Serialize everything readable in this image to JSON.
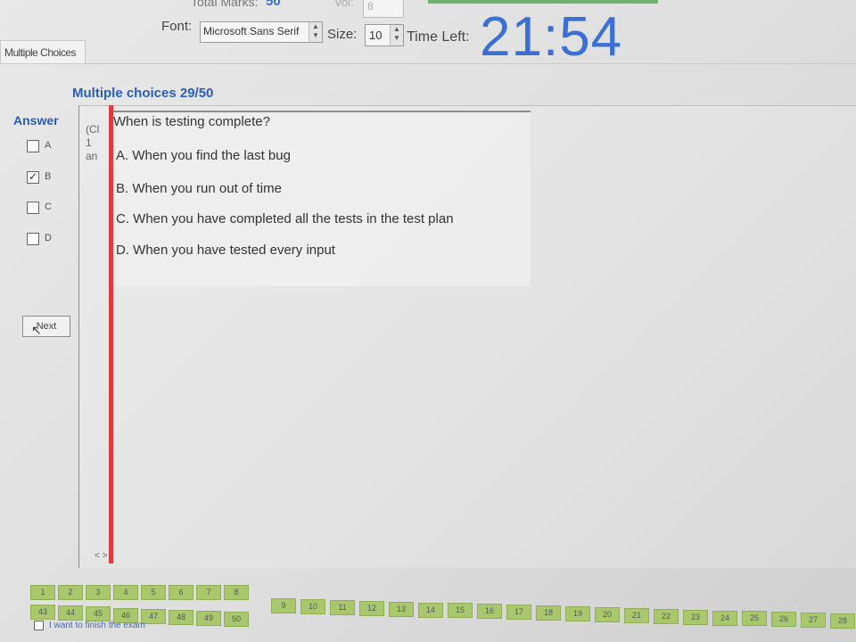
{
  "header": {
    "total_marks_label": "Total Marks:",
    "total_marks_value": "50",
    "vol_label": "Vol:",
    "vol_value": "8",
    "font_label": "Font:",
    "font_value": "Microsoft Sans Serif",
    "size_label": "Size:",
    "size_value": "10",
    "time_left_label": "Time Left:",
    "time_left_value": "21:54"
  },
  "tab": {
    "label": "Multiple Choices"
  },
  "section_title": "Multiple choices 29/50",
  "answer": {
    "title": "Answer",
    "options": [
      {
        "label": "A",
        "checked": false
      },
      {
        "label": "B",
        "checked": true
      },
      {
        "label": "C",
        "checked": false
      },
      {
        "label": "D",
        "checked": false
      }
    ],
    "next_label": "Next"
  },
  "side_column": {
    "line1": "(Cl",
    "line2": "1",
    "line3": "an",
    "arrows": "< >"
  },
  "question": {
    "text": "When is testing complete?",
    "options": [
      "A.  When you find the last bug",
      "B.  When you run out of time",
      "C.  When you have completed all the tests in the test plan",
      "D.  When you have tested every input"
    ]
  },
  "navigation": {
    "row1": [
      "1",
      "2",
      "3",
      "4",
      "5",
      "6",
      "7",
      "8",
      "9",
      "10",
      "11",
      "12",
      "13",
      "14",
      "15",
      "16",
      "17",
      "18",
      "19",
      "20",
      "21",
      "22",
      "23",
      "24",
      "25",
      "26",
      "27",
      "28"
    ],
    "row2": [
      "43",
      "44",
      "45",
      "46",
      "47",
      "48",
      "49",
      "50"
    ],
    "finish_label": "I want to finish the exam"
  },
  "colors": {
    "accent": "#3b6fd4",
    "nav_button": "#a9c86b",
    "marker": "#e03a3a"
  }
}
